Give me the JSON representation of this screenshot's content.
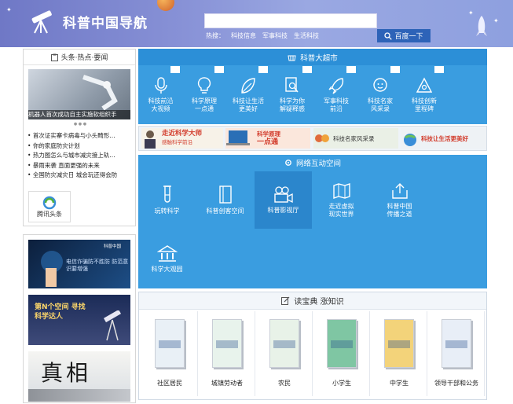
{
  "header": {
    "site_title": "科普中国导航",
    "hot_label": "热搜：",
    "hot_links": [
      "科技信息",
      "军事科技",
      "生活科技"
    ],
    "search_button": "百度一下",
    "search_placeholder": ""
  },
  "left": {
    "headline_title": "头条·热点·要闻",
    "headline_caption": "机器人首次成功自主实施软组织手",
    "headline_dots": "● ● ●",
    "news": [
      "首次证实寨卡病毒与小头畸形…",
      "你的家庭防灾计划",
      "热力图怎么与城市减灾接上轨…",
      "暴雨来袭 直面更强的未来",
      "全国防灾减灾日 城会玩还得会防"
    ],
    "partner": "腾讯头条",
    "ads": [
      {
        "text": "电信诈骗防不胜防 防范意识要增强",
        "tag": "科普中国"
      },
      {
        "text": "第N个空间 寻找科学达人",
        "tag": ""
      },
      {
        "text": "真相",
        "tag": ""
      }
    ]
  },
  "market": {
    "title": "科普大超市",
    "items": [
      {
        "label": "科技前沿\n大视频",
        "icon": "microphone-icon"
      },
      {
        "label": "科学原理\n一点通",
        "icon": "lightbulb-icon"
      },
      {
        "label": "科技让生活\n更美好",
        "icon": "leaf-icon"
      },
      {
        "label": "科学为你\n解疑释惑",
        "icon": "document-search-icon"
      },
      {
        "label": "军事科技\n前沿",
        "icon": "rocket-icon"
      },
      {
        "label": "科技名家\n风采录",
        "icon": "person-icon"
      },
      {
        "label": "科技创新\n里程碑",
        "icon": "eye-triangle-icon"
      }
    ],
    "banners": [
      "走近科学大师",
      "感触科学前沿",
      "科学原理",
      "一点通",
      "科技名家风采录",
      "科技让生活更美好"
    ]
  },
  "interaction": {
    "title": "网络互动空间",
    "items": [
      {
        "label": "玩转科学",
        "icon": "test-tube-icon"
      },
      {
        "label": "科普创客空间",
        "icon": "notebook-icon"
      },
      {
        "label": "科普影视厅",
        "icon": "video-camera-icon"
      },
      {
        "label": "走近虚拟\n现实世界",
        "icon": "map-icon"
      },
      {
        "label": "科普中国\n传播之道",
        "icon": "share-box-icon"
      },
      {
        "label": "科学大观园",
        "icon": "building-icon"
      }
    ]
  },
  "reader": {
    "title": "读宝典 涨知识",
    "books": [
      {
        "label": "社区居民",
        "cover": "#e9f0f6"
      },
      {
        "label": "城镇劳动者",
        "cover": "#e8f3ec"
      },
      {
        "label": "农民",
        "cover": "#e8f2e8"
      },
      {
        "label": "小学生",
        "cover": "#7fc6a3"
      },
      {
        "label": "中学生",
        "cover": "#f3d37a"
      },
      {
        "label": "领导干部和公务",
        "cover": "#e8eef7"
      }
    ]
  },
  "colors": {
    "header": "#7d86d0",
    "bar": "#2c8fd7",
    "cell": "#3a9de0",
    "search_btn": "#2d63b8"
  }
}
